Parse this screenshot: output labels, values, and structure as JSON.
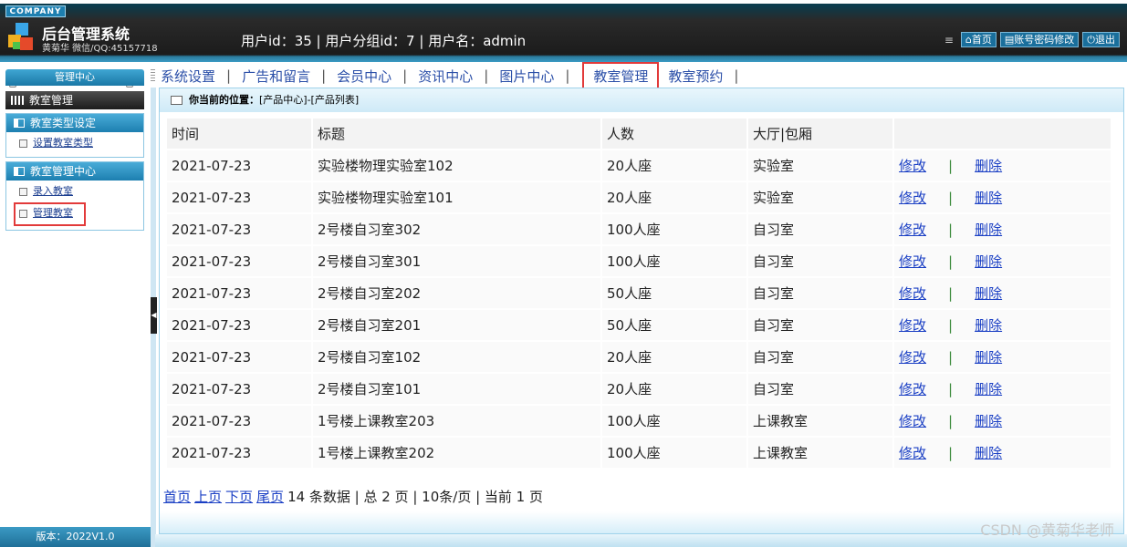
{
  "header": {
    "company": "COMPANY",
    "title": "后台管理系统",
    "subtitle": "黄菊华 微信/QQ:45157718",
    "user_info": "用户id：35 | 用户分组id：7 | 用户名：admin",
    "buttons": {
      "home": "首页",
      "account": "账号密码修改",
      "logout": "退出"
    }
  },
  "nav": {
    "items": [
      "系统设置",
      "广告和留言",
      "会员中心",
      "资讯中心",
      "图片中心",
      "教室管理",
      "教室预约"
    ],
    "separator": "|",
    "active": "教室管理"
  },
  "sidebar": {
    "head": "管理中心",
    "current": "教室管理",
    "groups": [
      {
        "title": "教室类型设定",
        "links": [
          "设置教室类型"
        ]
      },
      {
        "title": "教室管理中心",
        "links": [
          "录入教室",
          "管理教室"
        ]
      }
    ],
    "footer": "版本：2022V1.0"
  },
  "breadcrumb": {
    "label": "你当前的位置：",
    "path": "[产品中心]-[产品列表]"
  },
  "table": {
    "columns": [
      "时间",
      "标题",
      "人数",
      "大厅|包厢",
      ""
    ],
    "rows": [
      [
        "2021-07-23",
        "实验楼物理实验室102",
        "20人座",
        "实验室"
      ],
      [
        "2021-07-23",
        "实验楼物理实验室101",
        "20人座",
        "实验室"
      ],
      [
        "2021-07-23",
        "2号楼自习室302",
        "100人座",
        "自习室"
      ],
      [
        "2021-07-23",
        "2号楼自习室301",
        "100人座",
        "自习室"
      ],
      [
        "2021-07-23",
        "2号楼自习室202",
        "50人座",
        "自习室"
      ],
      [
        "2021-07-23",
        "2号楼自习室201",
        "50人座",
        "自习室"
      ],
      [
        "2021-07-23",
        "2号楼自习室102",
        "20人座",
        "自习室"
      ],
      [
        "2021-07-23",
        "2号楼自习室101",
        "20人座",
        "自习室"
      ],
      [
        "2021-07-23",
        "1号楼上课教室203",
        "100人座",
        "上课教室"
      ],
      [
        "2021-07-23",
        "1号楼上课教室202",
        "100人座",
        "上课教室"
      ]
    ],
    "actions": {
      "edit": "修改",
      "sep": "|",
      "delete": "删除"
    }
  },
  "pager": {
    "first": "首页",
    "prev": "上页",
    "next": "下页",
    "last": "尾页",
    "summary": "14 条数据 | 总 2 页 | 10条/页 | 当前 1 页"
  },
  "watermark": "CSDN @黄菊华老师",
  "colors": {
    "link": "#1a3fc4",
    "highlight": "#e23a3a",
    "accent": "#1d7fb0"
  }
}
